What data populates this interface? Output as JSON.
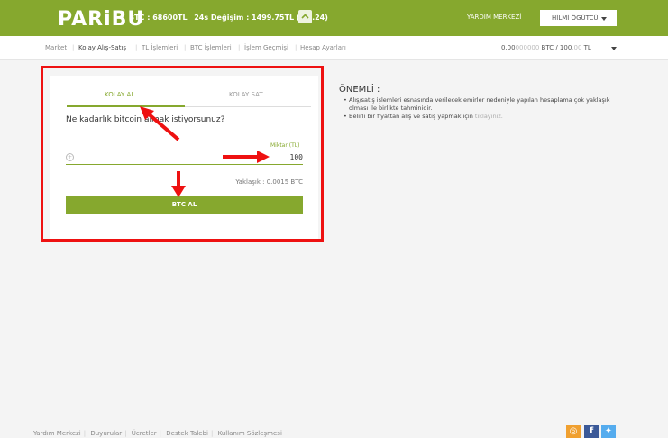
{
  "header": {
    "logo": "PARiBU",
    "ticker_btc": "BTC : 68600TL",
    "ticker_change": "24s Değişim : 1499.75TL (%2.24)",
    "help": "YARDIM MERKEZİ",
    "user": "HİLMİ ÖĞÜTCÜ"
  },
  "subnav": {
    "items": [
      "Market",
      "Kolay Alış-Satış",
      "TL İşlemleri",
      "BTC İşlemleri",
      "İşlem Geçmişi",
      "Hesap Ayarları"
    ],
    "balance_btc_main": "0.00",
    "balance_btc_dim": "000000",
    "balance_btc_suffix": " BTC / 100",
    "balance_tl_dim": ".00",
    "balance_tl_suffix": " TL"
  },
  "trade": {
    "tab_buy": "KOLAY AL",
    "tab_sell": "KOLAY SAT",
    "question": "Ne kadarlık bitcoin almak istiyorsunuz?",
    "amount_label": "Miktar (TL)",
    "amount_value": "100",
    "approx": "Yaklaşık : 0.0015 BTC",
    "buy_button": "BTC AL"
  },
  "notice": {
    "title": "ÖNEMLİ :",
    "note1": "Alış/satış işlemleri esnasında verilecek emirler nedeniyle yapılan hesaplama çok yaklaşık olması ile birlikte tahminidir.",
    "note2_prefix": "Belirli bir fiyattan alış ve satış yapmak için ",
    "note2_link": "tıklayınız."
  },
  "footer": {
    "links": [
      "Yardım Merkezi",
      "Duyurular",
      "Ücretler",
      "Destek Talebi",
      "Kullanım Sözleşmesi"
    ]
  },
  "colors": {
    "accent": "#86a82e",
    "annotation": "#e11111"
  }
}
